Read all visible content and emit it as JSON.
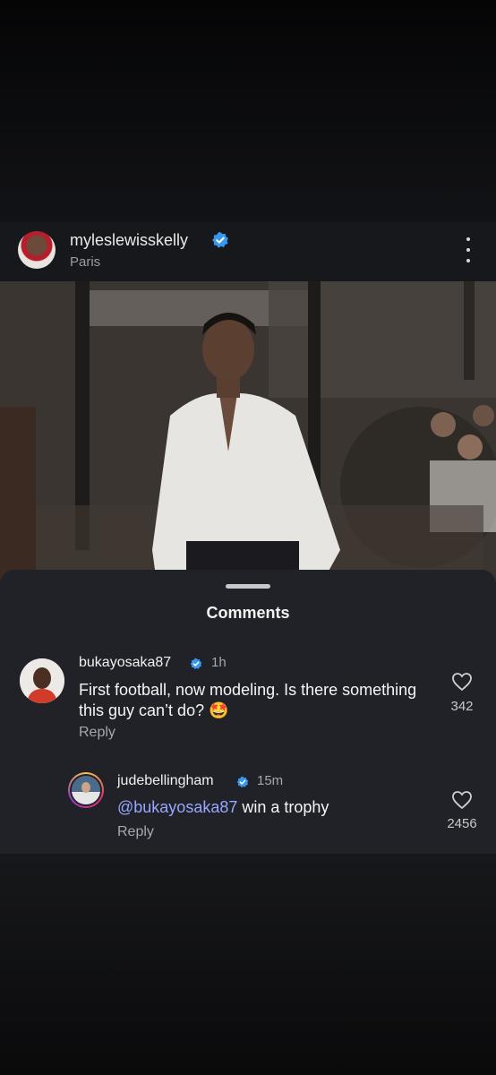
{
  "post": {
    "username": "myleslewisskelly",
    "location": "Paris"
  },
  "comments_sheet": {
    "title": "Comments"
  },
  "comments": [
    {
      "username": "bukayosaka87",
      "time": "1h",
      "text": "First football, now modeling. Is there something this guy can’t do? 🤩",
      "reply_label": "Reply",
      "likes": "342"
    },
    {
      "username": "judebellingham",
      "time": "15m",
      "mention": "@bukayosaka87",
      "text": " win a trophy",
      "reply_label": "Reply",
      "likes": "2456"
    }
  ],
  "colors": {
    "verified": "#3897f0",
    "mention": "#96a7ff",
    "sheet_bg": "#212227"
  },
  "icons": [
    "verified-badge-icon",
    "more-options-icon",
    "heart-icon"
  ]
}
